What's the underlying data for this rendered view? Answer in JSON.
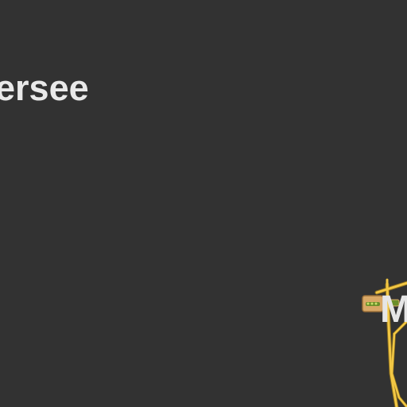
{
  "map": {
    "background_color": "#323232",
    "road_color": "#f2c744",
    "road_casing_color": "#8a6d1e",
    "labels": {
      "water_fragment": "ersee",
      "place_fragment": "M"
    },
    "icons": [
      "sign-icon"
    ]
  }
}
